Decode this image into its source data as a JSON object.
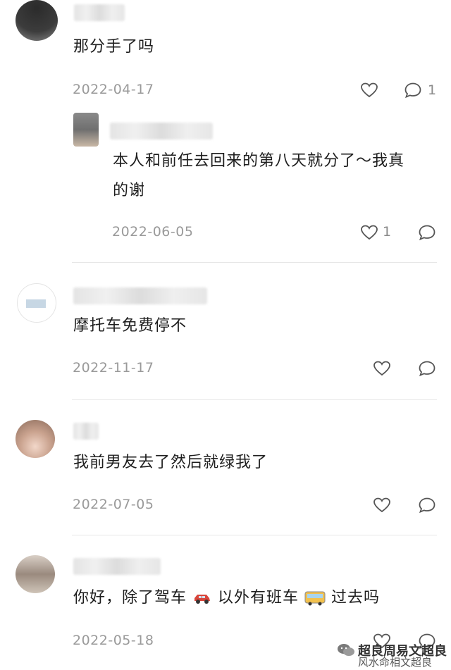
{
  "comments": [
    {
      "text": "那分手了吗",
      "date": "2022-04-17",
      "reply_count": "1"
    },
    {
      "text_line1": "本人和前任去回来的第八天就分了～我真",
      "text_line2": "的谢",
      "date": "2022-06-05",
      "like_count": "1"
    },
    {
      "text": "摩托车免费停不",
      "date": "2022-11-17"
    },
    {
      "text": "我前男友去了然后就绿我了",
      "date": "2022-07-05"
    },
    {
      "text_a": "你好，除了驾车",
      "text_b": "以外有班车",
      "text_c": "过去吗",
      "date": "2022-05-18"
    }
  ],
  "watermark": {
    "line1": "超良周易文超良",
    "line2": "风水命相文超良"
  },
  "icons": {
    "like": "heart-outline-icon",
    "comment": "speech-bubble-icon",
    "car": "car-emoji-icon",
    "bus": "bus-emoji-icon",
    "wechat": "wechat-logo-icon"
  }
}
